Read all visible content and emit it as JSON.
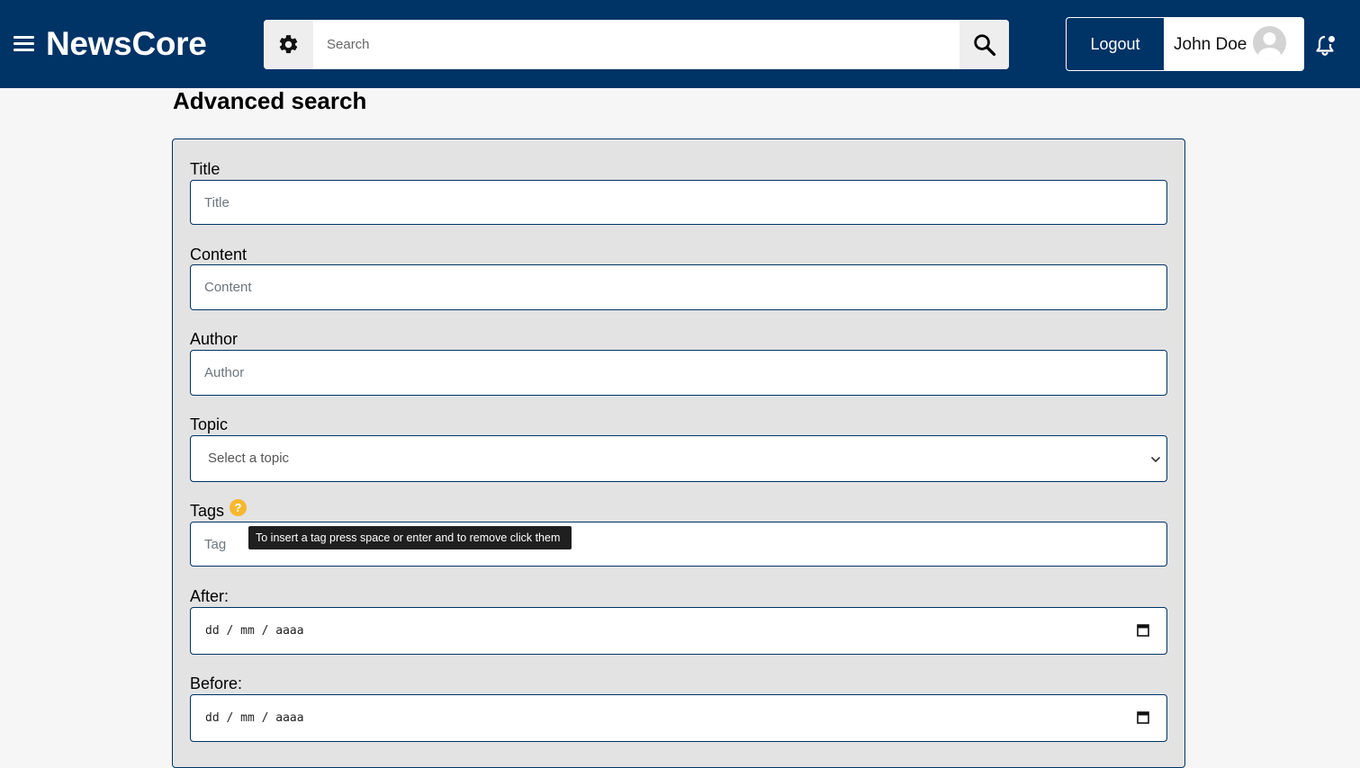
{
  "header": {
    "brand": "NewsCore",
    "search": {
      "placeholder": "Search"
    },
    "logout_label": "Logout",
    "user_name": "John Doe"
  },
  "page": {
    "title": "Advanced search"
  },
  "form": {
    "title": {
      "label": "Title",
      "placeholder": "Title"
    },
    "content": {
      "label": "Content",
      "placeholder": "Content"
    },
    "author": {
      "label": "Author",
      "placeholder": "Author"
    },
    "topic": {
      "label": "Topic",
      "selected": "Select a topic"
    },
    "tags": {
      "label": "Tags",
      "help_glyph": "?",
      "placeholder": "Tag",
      "tooltip": "To insert a tag press space or enter and to remove click them"
    },
    "after": {
      "label": "After:",
      "placeholder": "dd / mm / aaaa"
    },
    "before": {
      "label": "Before:",
      "placeholder": "dd / mm / aaaa"
    }
  },
  "colors": {
    "primary": "#003366",
    "panel_bg": "#e3e3e3",
    "page_bg": "#f6f6f6",
    "help_badge": "#f5b82e",
    "tooltip_bg": "#1f1f1f"
  },
  "icons": {
    "menu": "hamburger-menu-icon",
    "settings": "gear-icon",
    "search": "search-icon",
    "avatar": "user-avatar-icon",
    "notifications": "bell-icon",
    "select": "chevron-down-icon",
    "date": "calendar-icon",
    "help": "question-mark-icon"
  }
}
